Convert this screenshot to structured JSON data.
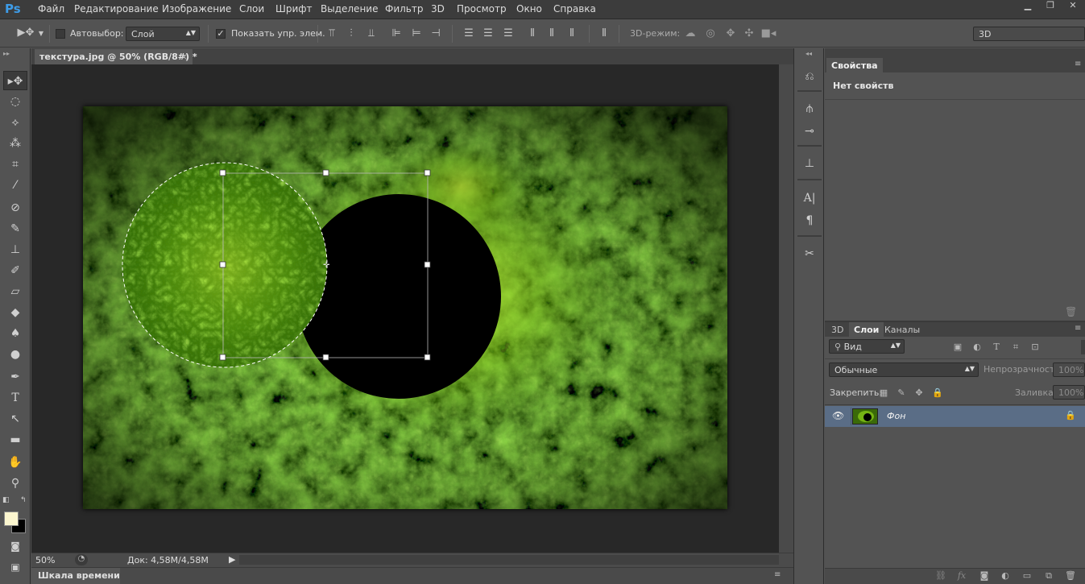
{
  "app": {
    "logo": "Ps"
  },
  "menu": [
    "Файл",
    "Редактирование",
    "Изображение",
    "Слои",
    "Шрифт",
    "Выделение",
    "Фильтр",
    "3D",
    "Просмотр",
    "Окно",
    "Справка"
  ],
  "options": {
    "autoselect_label": "Автовыбор:",
    "autoselect_target": "Слой",
    "show_controls_label": "Показать упр. элем.",
    "mode3d_label": "3D-режим:",
    "workspace": "3D"
  },
  "document": {
    "tab_title": "текстура.jpg @ 50% (RGB/8#) *",
    "zoom": "50%",
    "doc_info": "Док: 4,58M/4,58M"
  },
  "timeline": {
    "label": "Шкала времени"
  },
  "properties": {
    "tab": "Свойства",
    "message": "Нет свойств"
  },
  "layers_panel": {
    "tabs": [
      "3D",
      "Слои",
      "Каналы"
    ],
    "filter_kind": "Вид",
    "blend_mode": "Обычные",
    "opacity_label": "Непрозрачность:",
    "opacity_value": "100%",
    "lock_label": "Закрепить:",
    "fill_label": "Заливка:",
    "fill_value": "100%",
    "layers": [
      {
        "name": "Фон",
        "visible": true,
        "locked": true
      }
    ]
  },
  "colors": {
    "foreground": "#fbf6cf",
    "background": "#000000"
  }
}
